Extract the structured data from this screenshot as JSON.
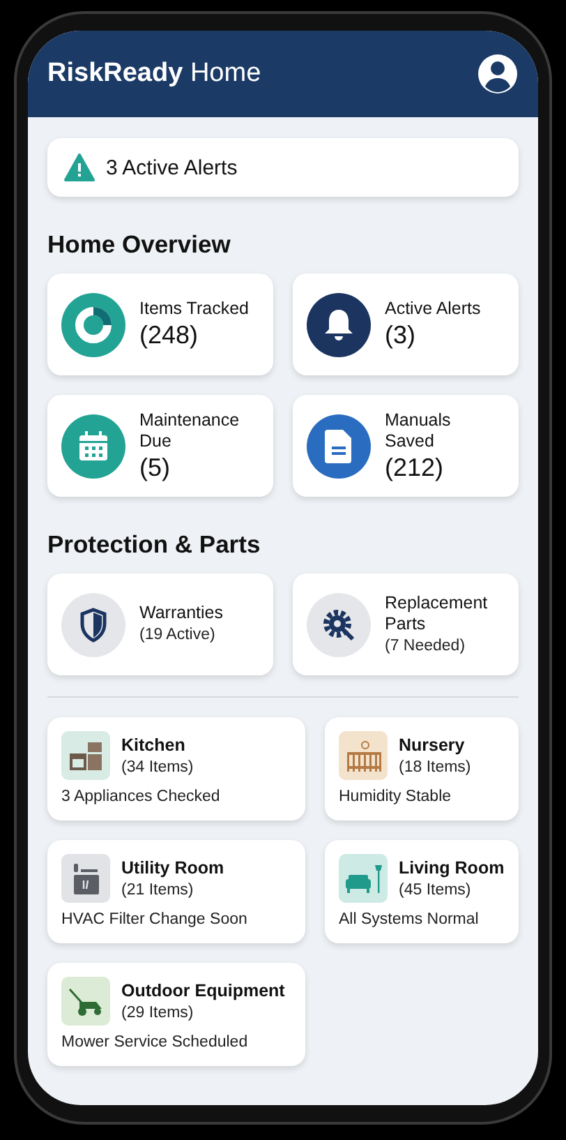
{
  "header": {
    "title": "**RiskReady** Home"
  },
  "alert_banner": {
    "text": "3 Active Alerts"
  },
  "home_overview": {
    "heading": "Home Overview",
    "stats": [
      {
        "label": "Items Tracked",
        "value": "(248)"
      },
      {
        "label": "Active Alerts",
        "value": "(3)"
      },
      {
        "label": "Maintenance Due",
        "value": "(5)"
      },
      {
        "label": "Manuals Saved",
        "value": "(212)"
      }
    ]
  },
  "protection": {
    "heading": "Protection & Parts",
    "items": [
      {
        "title": "Warranties",
        "subtitle": "(19 Active)"
      },
      {
        "title": "Replacement Parts",
        "subtitle": "(7 Needed)"
      }
    ]
  },
  "rooms": [
    {
      "name": "Kitchen",
      "count": "(34 Items)",
      "status": "3 Appliances Checked"
    },
    {
      "name": "Nursery",
      "count": "(18 Items)",
      "status": "Humidity Stable"
    },
    {
      "name": "Utility Room",
      "count": "(21 Items)",
      "status": "HVAC Filter Change Soon"
    },
    {
      "name": "Living Room",
      "count": "(45 Items)",
      "status": "All Systems Normal"
    },
    {
      "name": "Outdoor Equipment",
      "count": "(29 Items)",
      "status": "Mower Service Scheduled"
    }
  ]
}
